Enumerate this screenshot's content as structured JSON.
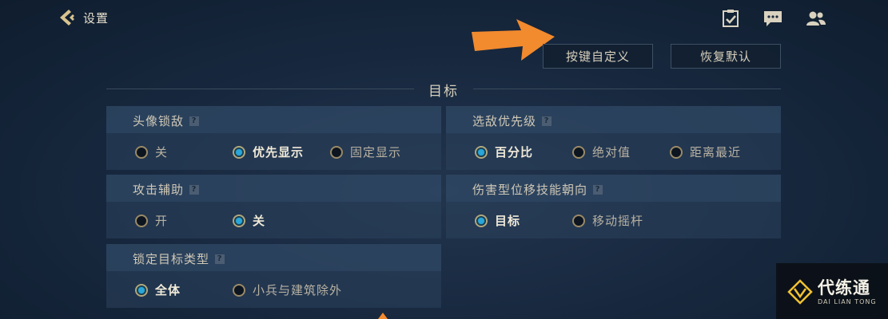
{
  "header": {
    "back_label": "设置"
  },
  "toolbar": {
    "customize_label": "按键自定义",
    "reset_label": "恢复默认"
  },
  "section": {
    "title": "目标"
  },
  "cards": [
    {
      "title": "头像锁敌",
      "options": [
        "关",
        "优先显示",
        "固定显示"
      ],
      "selected": 1
    },
    {
      "title": "选敌优先级",
      "options": [
        "百分比",
        "绝对值",
        "距离最近"
      ],
      "selected": 0
    },
    {
      "title": "攻击辅助",
      "options": [
        "开",
        "关"
      ],
      "selected": 1
    },
    {
      "title": "伤害型位移技能朝向",
      "options": [
        "目标",
        "移动摇杆"
      ],
      "selected": 0
    },
    {
      "title": "锁定目标类型",
      "options": [
        "全体",
        "小兵与建筑除外"
      ],
      "selected": 0
    }
  ],
  "help_glyph": "?",
  "icons": [
    "back-chevron-icon",
    "checklist-icon",
    "chat-icon",
    "friends-icon",
    "orange-arrow-icon"
  ],
  "colors": {
    "accent_blue": "#2aa6d8",
    "gold": "#b9a676",
    "arrow": "#f28a2e"
  },
  "watermark": {
    "title": "代练通",
    "subtitle": "DAI LIAN TONG"
  }
}
